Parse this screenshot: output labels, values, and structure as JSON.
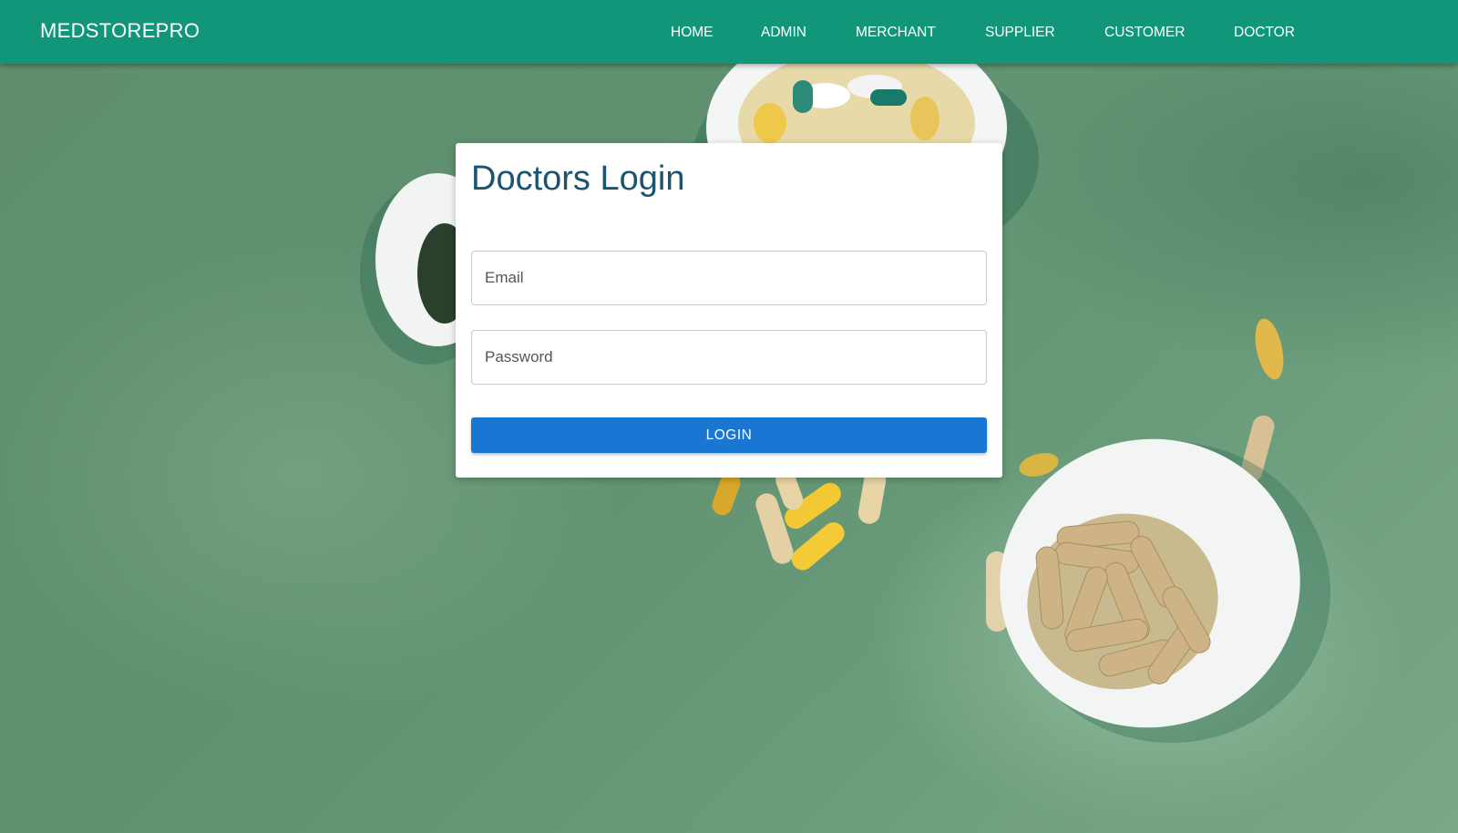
{
  "navbar": {
    "brand": "MEDSTOREPRO",
    "links": [
      {
        "label": "HOME"
      },
      {
        "label": "ADMIN"
      },
      {
        "label": "MERCHANT"
      },
      {
        "label": "SUPPLIER"
      },
      {
        "label": "CUSTOMER"
      },
      {
        "label": "DOCTOR"
      }
    ],
    "background_color": "#12967a"
  },
  "login_card": {
    "title": "Doctors Login",
    "email_placeholder": "Email",
    "password_placeholder": "Password",
    "login_button": "LOGIN",
    "button_color": "#1976d2",
    "title_color": "#1b5470"
  },
  "background": {
    "image": "green-surface-with-pill-bowls"
  }
}
